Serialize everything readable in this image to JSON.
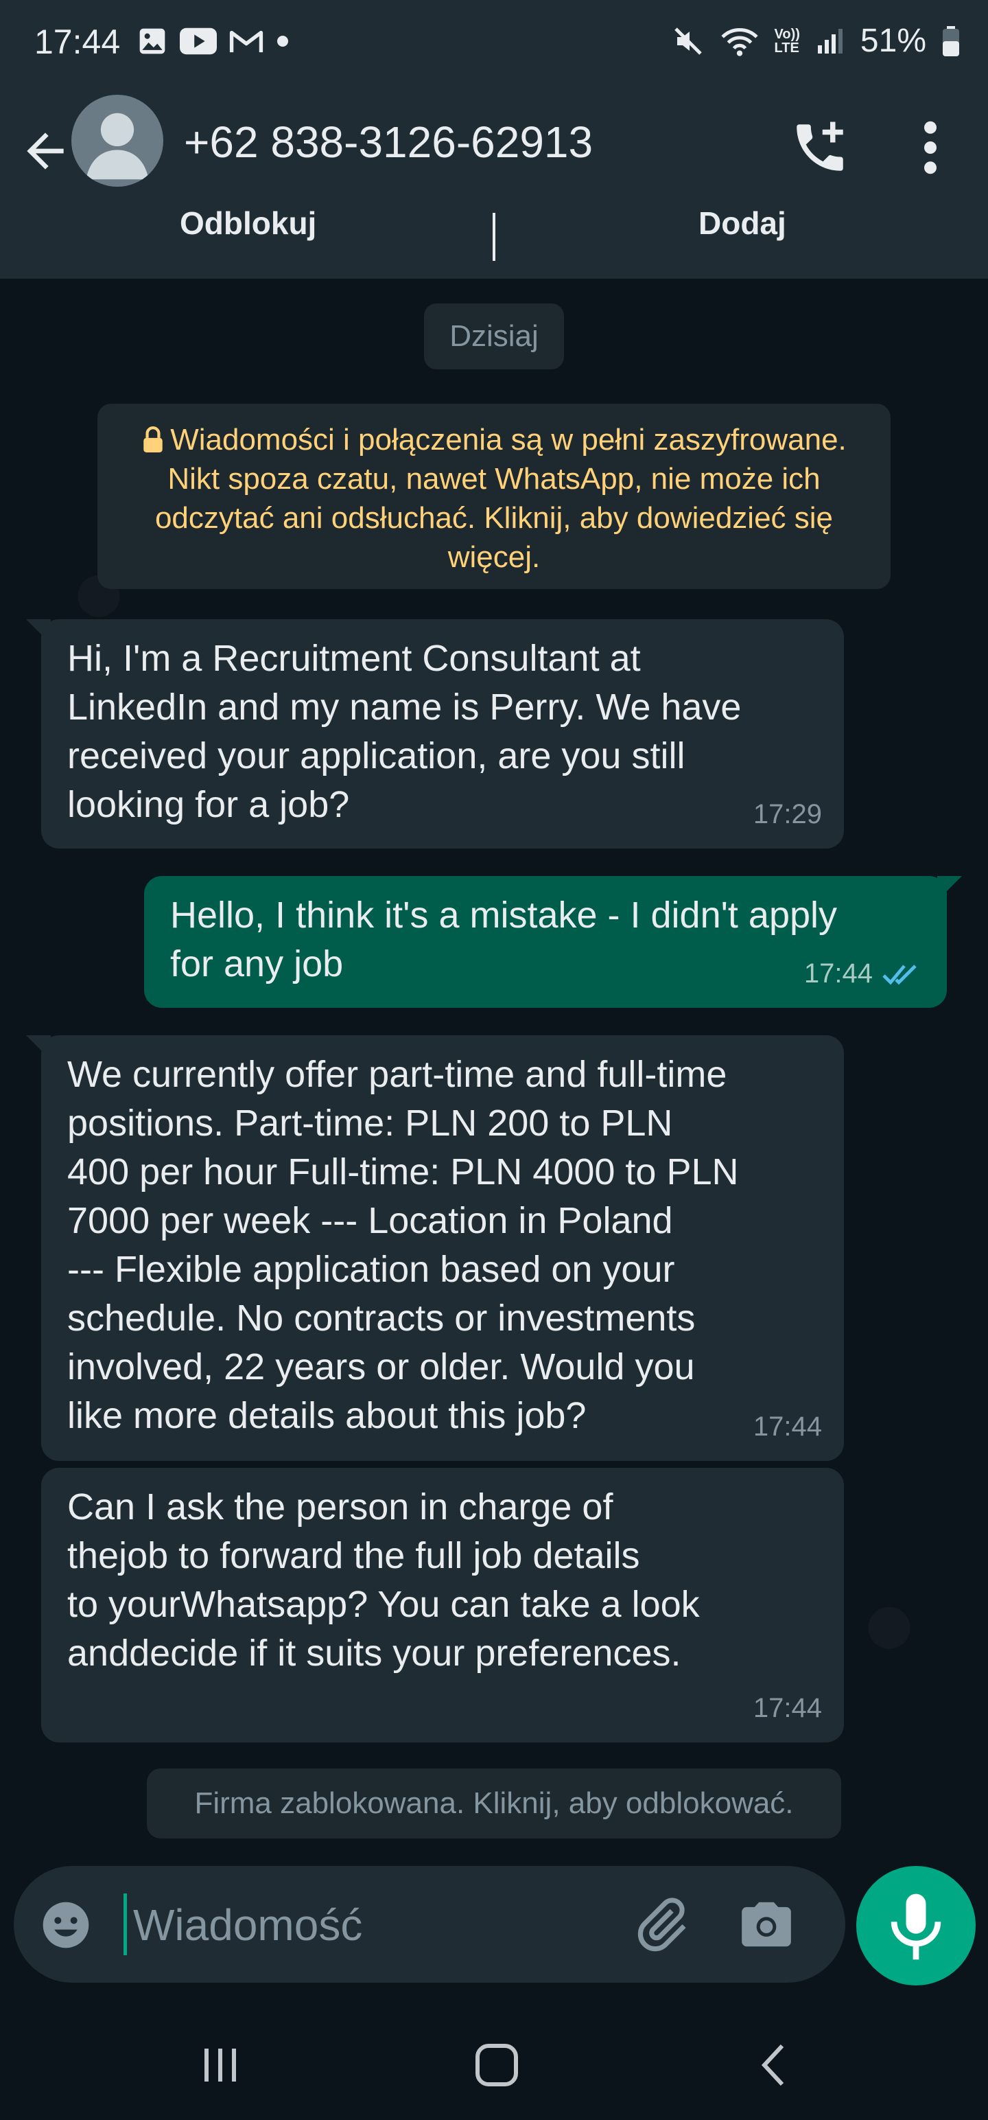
{
  "statusbar": {
    "time": "17:44",
    "battery": "51%",
    "lte_label_top": "Vo))",
    "lte_label_bottom": "LTE",
    "icons": [
      "gallery-icon",
      "youtube-icon",
      "gmail-icon",
      "dot-icon",
      "mute-icon",
      "wifi-icon",
      "signal-icon",
      "battery-icon"
    ]
  },
  "header": {
    "contact_name": "+62 838-3126-62913",
    "icons": [
      "back-arrow-icon",
      "avatar-icon",
      "add-call-icon",
      "more-vert-icon"
    ]
  },
  "actions": {
    "unblock_label": "Odblokuj",
    "add_label": "Dodaj"
  },
  "chat": {
    "date_chip": "Dzisiaj",
    "encryption_notice": "Wiadomości i połączenia są w pełni zaszyfrowane. Nikt spoza czatu, nawet WhatsApp, nie może ich odczytać ani odsłuchać. Kliknij, aby dowiedzieć się więcej.",
    "messages": [
      {
        "direction": "incoming",
        "text": "Hi, I'm a Recruitment Consultant at\nLinkedIn and my name is Perry. We have\nreceived your application, are you still\nlooking for a job?",
        "time": "17:29"
      },
      {
        "direction": "outgoing",
        "text": "Hello, I think it's a mistake - I didn't apply\nfor any job",
        "time": "17:44",
        "status": "read"
      },
      {
        "direction": "incoming",
        "text": "We currently offer part-time and full-time\npositions. Part-time: PLN 200 to PLN\n400 per hour Full-time: PLN 4000 to PLN\n7000 per week --- Location in Poland\n--- Flexible application based on your\nschedule. No contracts or investments\ninvolved, 22 years or older. Would you\nlike more details about this job?",
        "time": "17:44"
      },
      {
        "direction": "incoming",
        "text": "Can I ask the person in charge of\nthejob to forward the full job details\nto yourWhatsapp? You can take a look\nanddecide if it suits your preferences.",
        "time": "17:44"
      }
    ],
    "blocked_notice": "Firma zablokowana. Kliknij, aby odblokować."
  },
  "composer": {
    "placeholder": "Wiadomość",
    "icons": [
      "emoji-icon",
      "attach-icon",
      "camera-icon",
      "mic-icon"
    ]
  },
  "navbar": {
    "icons": [
      "recents-icon",
      "home-icon",
      "back-icon"
    ]
  },
  "colors": {
    "background": "#0b141a",
    "header": "#1f2c34",
    "incoming_bubble": "#202c33",
    "outgoing_bubble": "#005c4b",
    "accent": "#00a884",
    "encryption_text": "#ffd279",
    "read_ticks": "#53bdeb"
  }
}
